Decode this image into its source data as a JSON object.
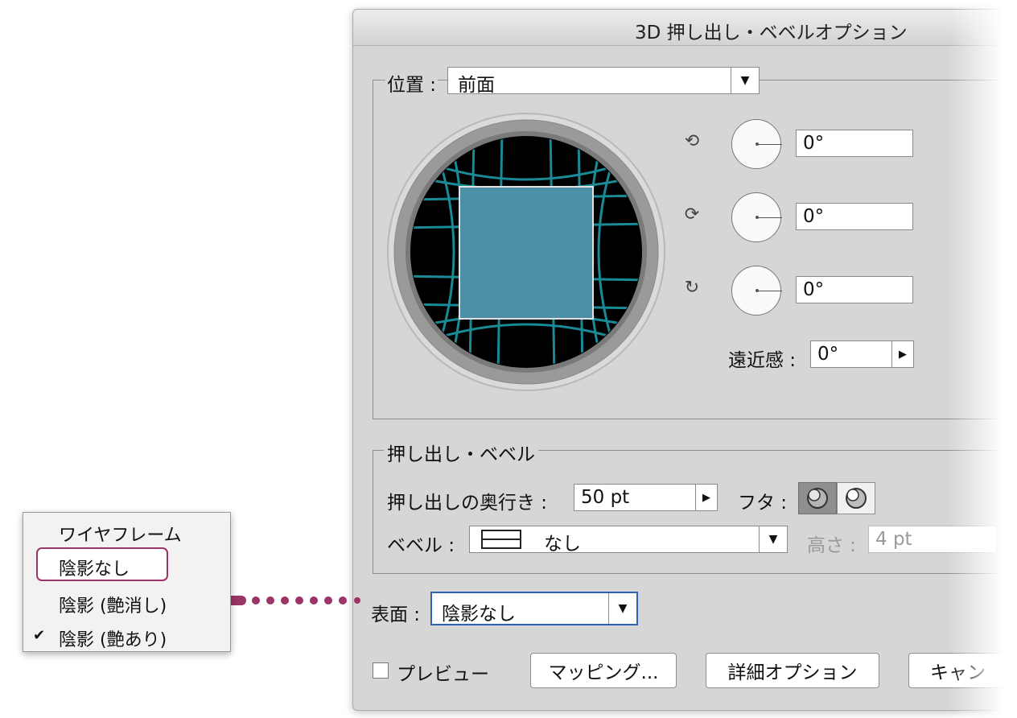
{
  "dialog": {
    "title": "3D 押し出し・ベベルオプション",
    "position": {
      "label": "位置 :",
      "value": "前面",
      "rotations": [
        {
          "axis": "x-axis-rotate-icon",
          "value": "0°"
        },
        {
          "axis": "y-axis-rotate-icon",
          "value": "0°"
        },
        {
          "axis": "z-axis-rotate-icon",
          "value": "0°"
        }
      ],
      "perspective_label": "遠近感 :",
      "perspective_value": "0°"
    },
    "extrude": {
      "group_label": "押し出し・ベベル",
      "depth_label": "押し出しの奥行き :",
      "depth_value": "50 pt",
      "cap_label": "フタ :",
      "bevel_label": "ベベル :",
      "bevel_value": "なし",
      "height_label": "高さ :",
      "height_value": "4 pt"
    },
    "surface": {
      "label": "表面 :",
      "value": "陰影なし"
    },
    "preview_label": "プレビュー",
    "buttons": {
      "mapping": "マッピング...",
      "more_options": "詳細オプション",
      "cancel": "キャン"
    }
  },
  "surface_menu": {
    "items": [
      {
        "label": "ワイヤフレーム",
        "checked": false
      },
      {
        "label": "陰影なし",
        "checked": false,
        "highlighted": true
      },
      {
        "label": "陰影 (艶消し)",
        "checked": false
      },
      {
        "label": "陰影 (艶あり)",
        "checked": true
      }
    ],
    "check_mark": "✔"
  },
  "colors": {
    "accent_annotation": "#9b3467",
    "cube_face": "#4e8fa8",
    "grid_line": "#1a8a96"
  }
}
